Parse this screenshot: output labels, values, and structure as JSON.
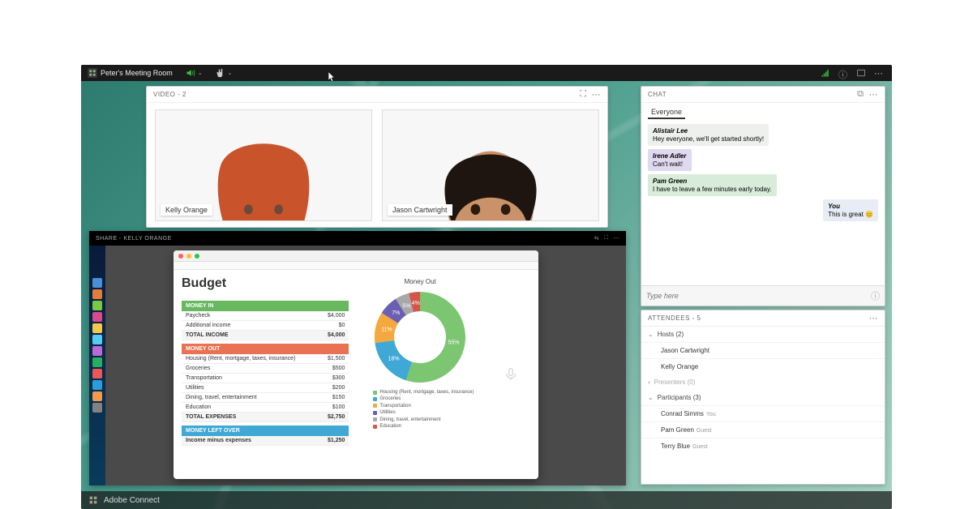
{
  "app": {
    "title": "Peter's Meeting Room",
    "footer": "Adobe Connect"
  },
  "video": {
    "header": "VIDEO - 2",
    "tiles": [
      {
        "name": "Kelly Orange"
      },
      {
        "name": "Jason Cartwright"
      }
    ]
  },
  "share": {
    "header": "SHARE - KELLY ORANGE",
    "doc_title": "Budget",
    "money_in_label": "MONEY IN",
    "money_in": [
      {
        "label": "Paycheck",
        "value": "$4,000"
      },
      {
        "label": "Additional income",
        "value": "$0"
      }
    ],
    "money_in_total": {
      "label": "TOTAL INCOME",
      "value": "$4,000"
    },
    "money_out_label": "MONEY OUT",
    "money_out": [
      {
        "label": "Housing (Rent, mortgage, taxes, insurance)",
        "value": "$1,500"
      },
      {
        "label": "Groceries",
        "value": "$500"
      },
      {
        "label": "Transportation",
        "value": "$300"
      },
      {
        "label": "Utilities",
        "value": "$200"
      },
      {
        "label": "Dining, travel, entertainment",
        "value": "$150"
      },
      {
        "label": "Education",
        "value": "$100"
      }
    ],
    "money_out_total": {
      "label": "TOTAL EXPENSES",
      "value": "$2,750"
    },
    "money_left_label": "MONEY LEFT OVER",
    "money_left": {
      "label": "Income minus expenses",
      "value": "$1,250"
    }
  },
  "chart_data": {
    "type": "pie",
    "title": "Money Out",
    "categories": [
      "Housing (Rent, mortgage, taxes, insurance)",
      "Groceries",
      "Transportation",
      "Utilities",
      "Dining, travel, entertainment",
      "Education"
    ],
    "values": [
      55,
      18,
      11,
      7,
      5,
      4
    ],
    "colors": [
      "#7cc671",
      "#3fa8d4",
      "#f4a83d",
      "#6b5fb3",
      "#a8a8a8",
      "#d4554a"
    ],
    "label_suffix": "%"
  },
  "chat": {
    "header": "CHAT",
    "tab": "Everyone",
    "placeholder": "Type here",
    "messages": [
      {
        "from": "Alistair Lee",
        "text": "Hey everyone, we'll get started shortly!",
        "bg": "#eef0ee",
        "side": "l"
      },
      {
        "from": "Irene Adler",
        "text": "Can't wait!",
        "bg": "#e0daf0",
        "side": "l"
      },
      {
        "from": "Pam Green",
        "text": "I have to leave a few minutes early today.",
        "bg": "#d9ecd9",
        "side": "l"
      },
      {
        "from": "You",
        "text": "This is great 😊",
        "bg": "#e8edf5",
        "side": "r"
      }
    ]
  },
  "attendees": {
    "header": "ATTENDEES - 5",
    "hosts_label": "Hosts (2)",
    "hosts": [
      "Jason Cartwright",
      "Kelly Orange"
    ],
    "presenters_label": "Presenters (0)",
    "participants_label": "Participants (3)",
    "participants": [
      {
        "name": "Conrad Simms",
        "tag": "You"
      },
      {
        "name": "Pam Green",
        "tag": "Guest"
      },
      {
        "name": "Terry Blue",
        "tag": "Guest"
      }
    ]
  },
  "colors": {
    "bandIn": "#67b85f",
    "bandOut": "#e97254",
    "bandLeft": "#3fa8d4"
  }
}
